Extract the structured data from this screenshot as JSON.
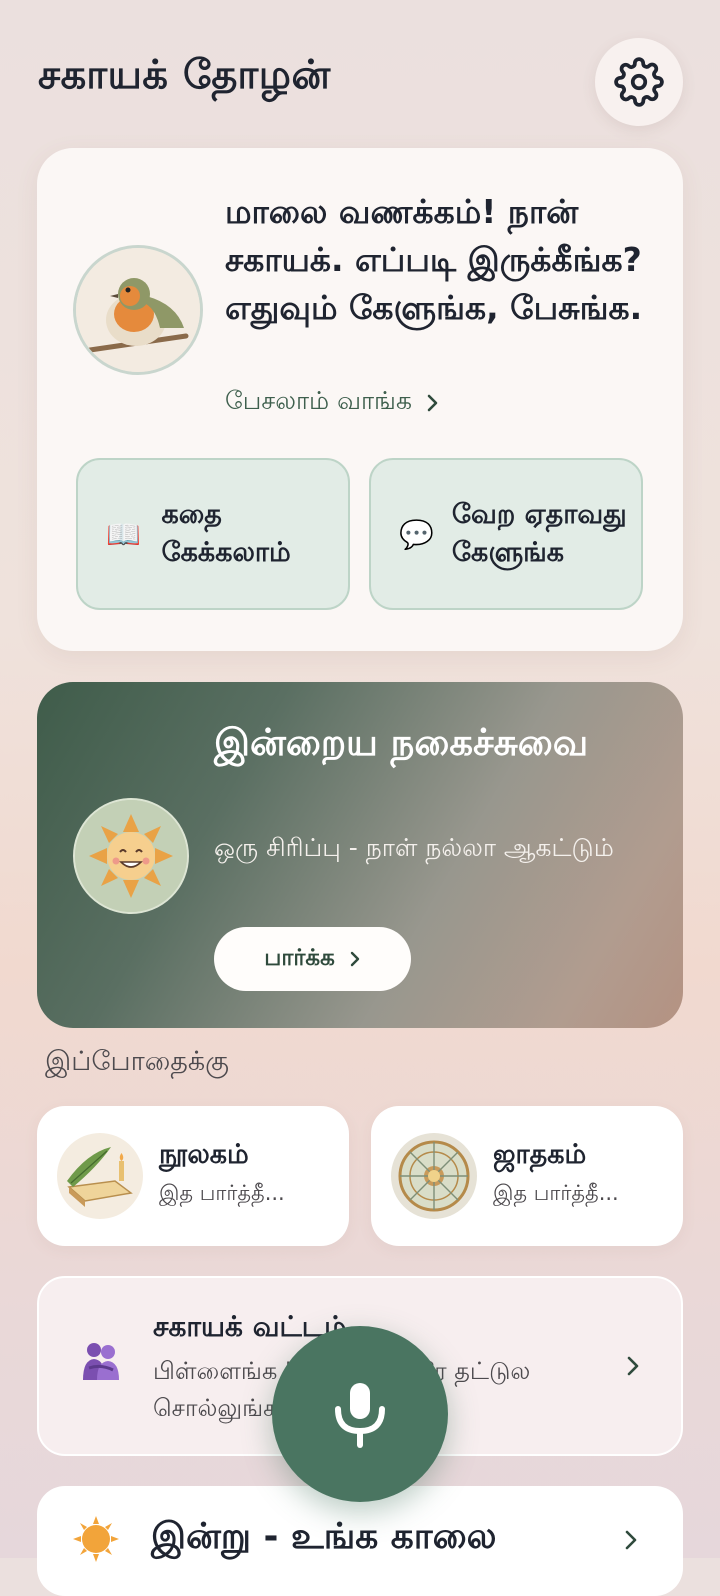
{
  "app": {
    "title": "சகாயக் தோழன்"
  },
  "header": {
    "settings_icon": "gear-icon"
  },
  "welcome": {
    "message": "மாலை வணக்கம்! நான் சகாயக். எப்படி இருக்கீங்க? எதுவும் கேளுங்க, பேசுங்க.",
    "link_label": "பேசலாம் வாங்க",
    "avatar_icon": "robin-bird-avatar",
    "chips": [
      {
        "emoji": "📖",
        "label": "கதை கேக்கலாம்"
      },
      {
        "emoji": "💬",
        "label": "வேற ஏதாவது கேளுங்க"
      }
    ]
  },
  "joke": {
    "title": "இன்றைய நகைச்சுவை",
    "subtitle": "ஒரு சிரிப்பு - நாள் நல்லா ஆகட்டும்",
    "button_label": "பார்க்க",
    "avatar_icon": "smiling-sun-avatar"
  },
  "section": {
    "label": "இப்போதைக்கு"
  },
  "tiles": [
    {
      "title": "நூலகம்",
      "subtitle": "இத பார்த்தீ...",
      "icon": "book-library-icon"
    },
    {
      "title": "ஜாதகம்",
      "subtitle": "இத பார்த்தீ...",
      "icon": "zodiac-wheel-icon"
    }
  ],
  "circle": {
    "title": "சகாயக் வட்டம்",
    "description": "பிள்ளைங்க \"நலம்\"னு ஒரே தட்டுல சொல்லுங்க.",
    "icon": "people-hug-icon"
  },
  "today": {
    "title": "இன்று - உங்க காலை",
    "icon": "sun-icon"
  },
  "mic": {
    "icon": "microphone-icon"
  },
  "colors": {
    "accent": "#4a7561",
    "chip_bg": "#e2ece6",
    "link": "#3e5f4d"
  }
}
